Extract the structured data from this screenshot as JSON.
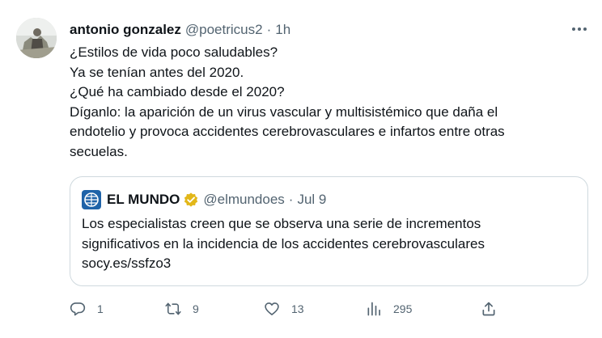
{
  "tweet": {
    "author_name": "antonio gonzalez",
    "handle": "@poetricus2",
    "separator": "·",
    "time": "1h",
    "lines": [
      "¿Estilos de vida poco saludables?",
      "Ya se tenían antes del 2020.",
      "¿Qué ha cambiado desde el 2020?",
      "Díganlo: la aparición de un virus vascular y multisistémico que daña el",
      "endotelio y provoca accidentes cerebrovasculares e infartos entre otras",
      "secuelas."
    ]
  },
  "quote": {
    "author_name": "EL MUNDO",
    "handle": "@elmundoes",
    "separator": "·",
    "date": "Jul 9",
    "lines": [
      "Los especialistas creen que se observa una serie de incrementos",
      "significativos en la incidencia de los accidentes cerebrovasculares",
      "socy.es/ssfzo3"
    ],
    "logo_color": "#1f63a8",
    "verified_color": "#e2b719"
  },
  "actions": {
    "reply_count": "1",
    "retweet_count": "9",
    "like_count": "13",
    "views_count": "295"
  },
  "icons": [
    "reply-icon",
    "retweet-icon",
    "like-icon",
    "views-icon",
    "share-icon",
    "more-icon",
    "verified-icon"
  ]
}
